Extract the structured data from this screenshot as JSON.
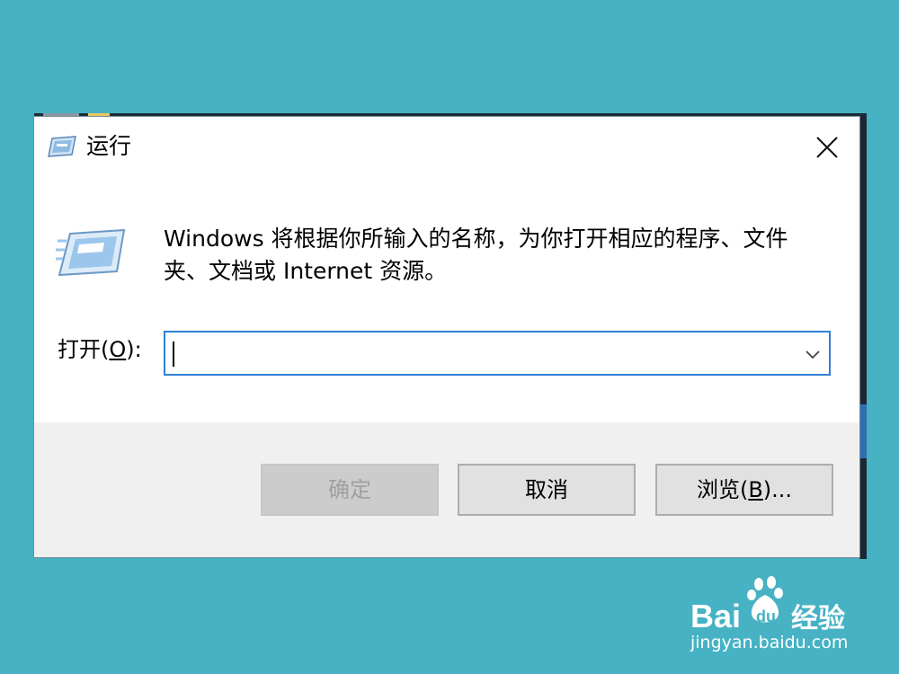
{
  "dialog": {
    "title": "运行",
    "message": "Windows 将根据你所输入的名称，为你打开相应的程序、文件夹、文档或 Internet 资源。",
    "open_label_prefix": "打开(",
    "open_label_key": "O",
    "open_label_suffix": "):",
    "open_value": "",
    "buttons": {
      "ok": "确定",
      "cancel": "取消",
      "browse_prefix": "浏览(",
      "browse_key": "B",
      "browse_suffix": ")..."
    }
  },
  "watermark": {
    "brand": "Bai du 经验",
    "url": "jingyan.baidu.com"
  },
  "colors": {
    "desktop": "#46b2c4",
    "focus_border": "#2e7fd4",
    "footer": "#f0f0f0"
  }
}
